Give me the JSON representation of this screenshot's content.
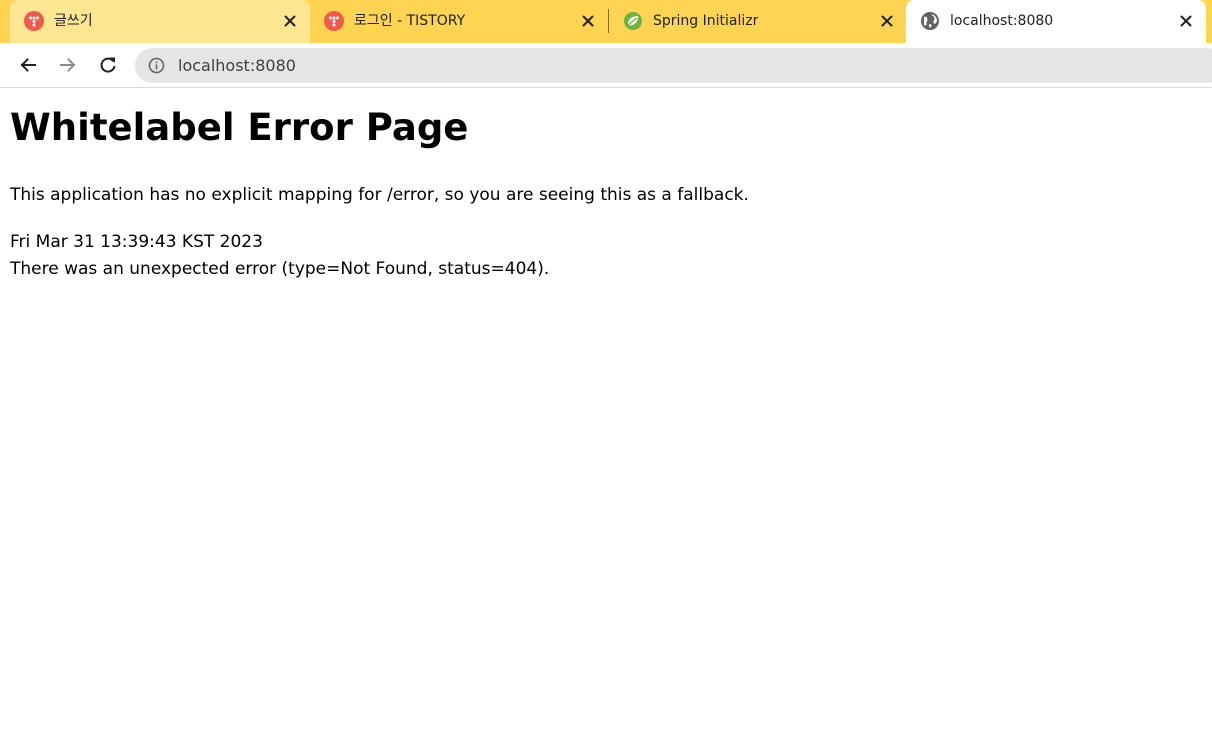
{
  "tabs": [
    {
      "title": "글쓰기",
      "favicon": "tistory-icon",
      "active": false
    },
    {
      "title": "로그인 - TISTORY",
      "favicon": "tistory-icon",
      "active": false
    },
    {
      "title": "Spring Initializr",
      "favicon": "spring-leaf-icon",
      "active": false
    },
    {
      "title": "localhost:8080",
      "favicon": "globe-icon",
      "active": true
    }
  ],
  "toolbar": {
    "url": "localhost:8080"
  },
  "page": {
    "heading": "Whitelabel Error Page",
    "fallback_message": "This application has no explicit mapping for /error, so you are seeing this as a fallback.",
    "timestamp": "Fri Mar 31 13:39:43 KST 2023",
    "error_message": "There was an unexpected error (type=Not Found, status=404)."
  },
  "colors": {
    "tabstrip": "#ffd452",
    "inactive_tab": "#ffe693",
    "tistory": "#f15a4a",
    "spring": "#6db33f"
  }
}
